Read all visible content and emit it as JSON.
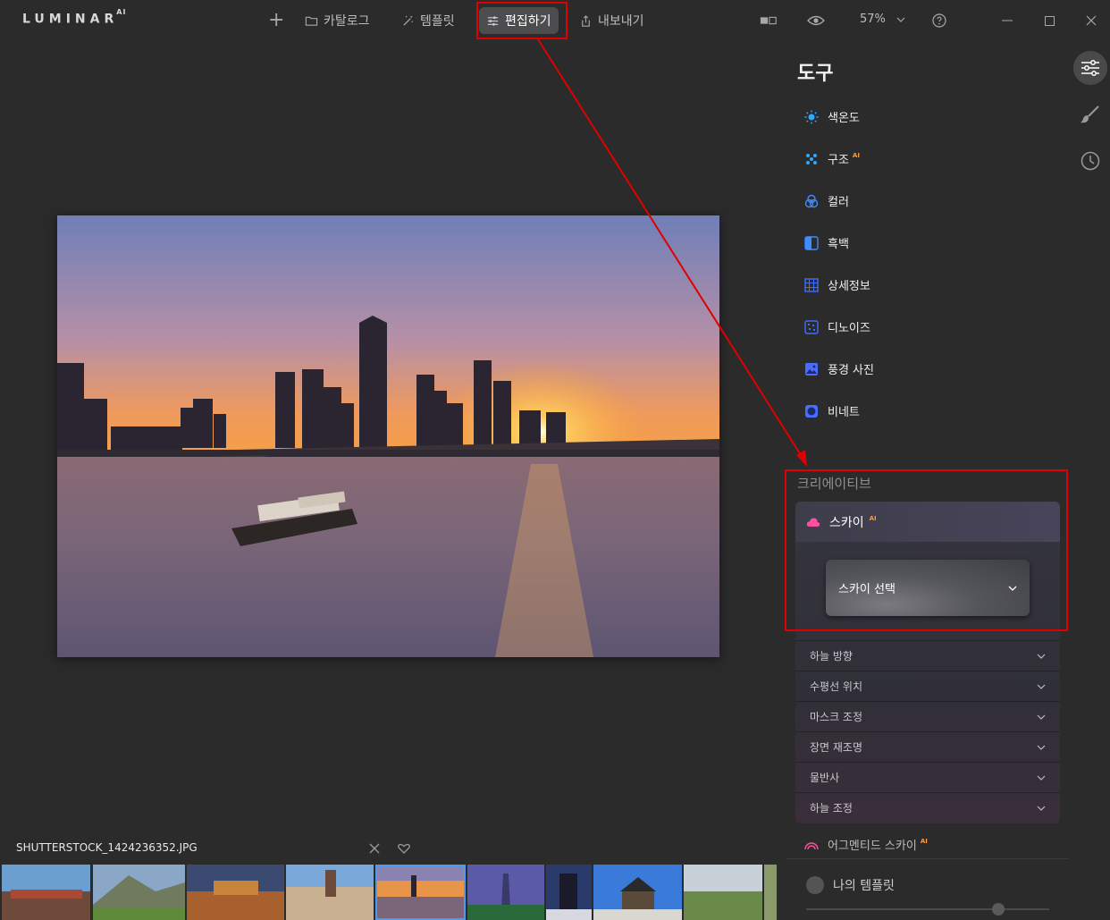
{
  "app": {
    "logo": "LUMINAR",
    "logo_sup": "AI"
  },
  "toolbar": {
    "add_label": "+",
    "catalog_label": "카탈로그",
    "templates_label": "템플릿",
    "edit_label": "편집하기",
    "export_label": "내보내기",
    "zoom": "57%"
  },
  "tools": {
    "title": "도구",
    "items": [
      {
        "label": "색온도",
        "icon": "sun-icon",
        "color": "#2fa8ff"
      },
      {
        "label": "구조",
        "icon": "dots-icon",
        "color": "#2fa8ff",
        "ai": "AI"
      },
      {
        "label": "컬러",
        "icon": "color-circles-icon",
        "color": "#3f8cff"
      },
      {
        "label": "흑백",
        "icon": "half-square-icon",
        "color": "#3f8cff"
      },
      {
        "label": "상세정보",
        "icon": "grid-icon",
        "color": "#3f6dff"
      },
      {
        "label": "디노이즈",
        "icon": "noise-icon",
        "color": "#3f6dff"
      },
      {
        "label": "풍경 사진",
        "icon": "landscape-icon",
        "color": "#4a6cff"
      },
      {
        "label": "비네트",
        "icon": "vignette-icon",
        "color": "#4a6cff"
      }
    ]
  },
  "creative": {
    "label": "크리에이티브",
    "sky": {
      "label": "스카이",
      "ai": "AI",
      "select_label": "스카이 선택",
      "color": "#ff4fa3"
    },
    "accordions": [
      "하늘 방향",
      "수평선 위치",
      "마스크 조정",
      "장면 재조명",
      "물반사",
      "하늘 조정"
    ],
    "augmented": {
      "label": "어그멘티드 스카이",
      "ai": "AI"
    }
  },
  "my_templates": {
    "label": "나의 템플릿"
  },
  "filmstrip": {
    "filename": "SHUTTERSTOCK_1424236352.JPG"
  }
}
